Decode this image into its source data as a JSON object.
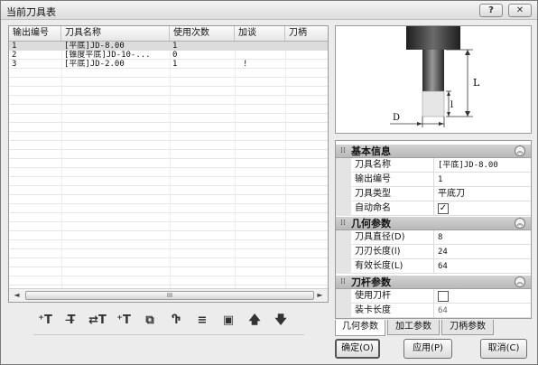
{
  "window": {
    "title": "当前刀具表",
    "help_label": "?",
    "close_label": "✕"
  },
  "table": {
    "columns": [
      "输出编号",
      "刀具名称",
      "使用次数",
      "加谈",
      "刀柄"
    ],
    "rows": [
      {
        "id": "1",
        "name": "[平底]JD-8.00",
        "count": "1",
        "extra": ""
      },
      {
        "id": "2",
        "name": "[锥度平底]JD-10-...",
        "count": "0",
        "extra": ""
      },
      {
        "id": "3",
        "name": "[平底]JD-2.00",
        "count": "1",
        "extra": "!"
      }
    ],
    "scroll_left": "◄",
    "scroll_right": "►",
    "scroll_grip": "III"
  },
  "toolbar": {
    "tools": [
      {
        "name": "add-tool-icon",
        "glyph": "⁺T"
      },
      {
        "name": "delete-tool-icon",
        "glyph": "T̶"
      },
      {
        "name": "edit-tool-icon",
        "glyph": "⇄T"
      },
      {
        "name": "insert-tool-icon",
        "glyph": "⁺T"
      },
      {
        "name": "copy-tool-icon",
        "glyph": "⧉"
      },
      {
        "name": "holder-icon",
        "glyph": "Ⴅ"
      },
      {
        "name": "list-tool-icon",
        "glyph": "≡"
      },
      {
        "name": "save-tool-icon",
        "glyph": "▣"
      },
      {
        "name": "move-up-icon",
        "glyph": "🡅"
      },
      {
        "name": "move-down-icon",
        "glyph": "🡇"
      }
    ]
  },
  "preview": {
    "label_L": "L",
    "label_l": "l",
    "label_D": "D"
  },
  "props": {
    "basic": {
      "title": "基本信息",
      "name_label": "刀具名称",
      "name_value": "[平底]JD-8.00",
      "num_label": "输出编号",
      "num_value": "1",
      "type_label": "刀具类型",
      "type_value": "平底刀",
      "auto_label": "自动命名",
      "auto_checked": "✓"
    },
    "geometry": {
      "title": "几何参数",
      "dia_label": "刀具直径(D)",
      "dia_value": "8",
      "blade_label": "刀刃长度(l)",
      "blade_value": "24",
      "eff_label": "有效长度(L)",
      "eff_value": "64"
    },
    "holder": {
      "title": "刀杆参数",
      "use_label": "使用刀杆",
      "use_checked": "",
      "clamp_label": "装卡长度",
      "clamp_value": "64"
    },
    "collapse_icon": "︽"
  },
  "tabs": [
    "几何参数",
    "加工参数",
    "刀柄参数"
  ],
  "buttons": {
    "ok": "确定(O)",
    "apply": "应用(P)",
    "cancel": "取消(C)"
  }
}
